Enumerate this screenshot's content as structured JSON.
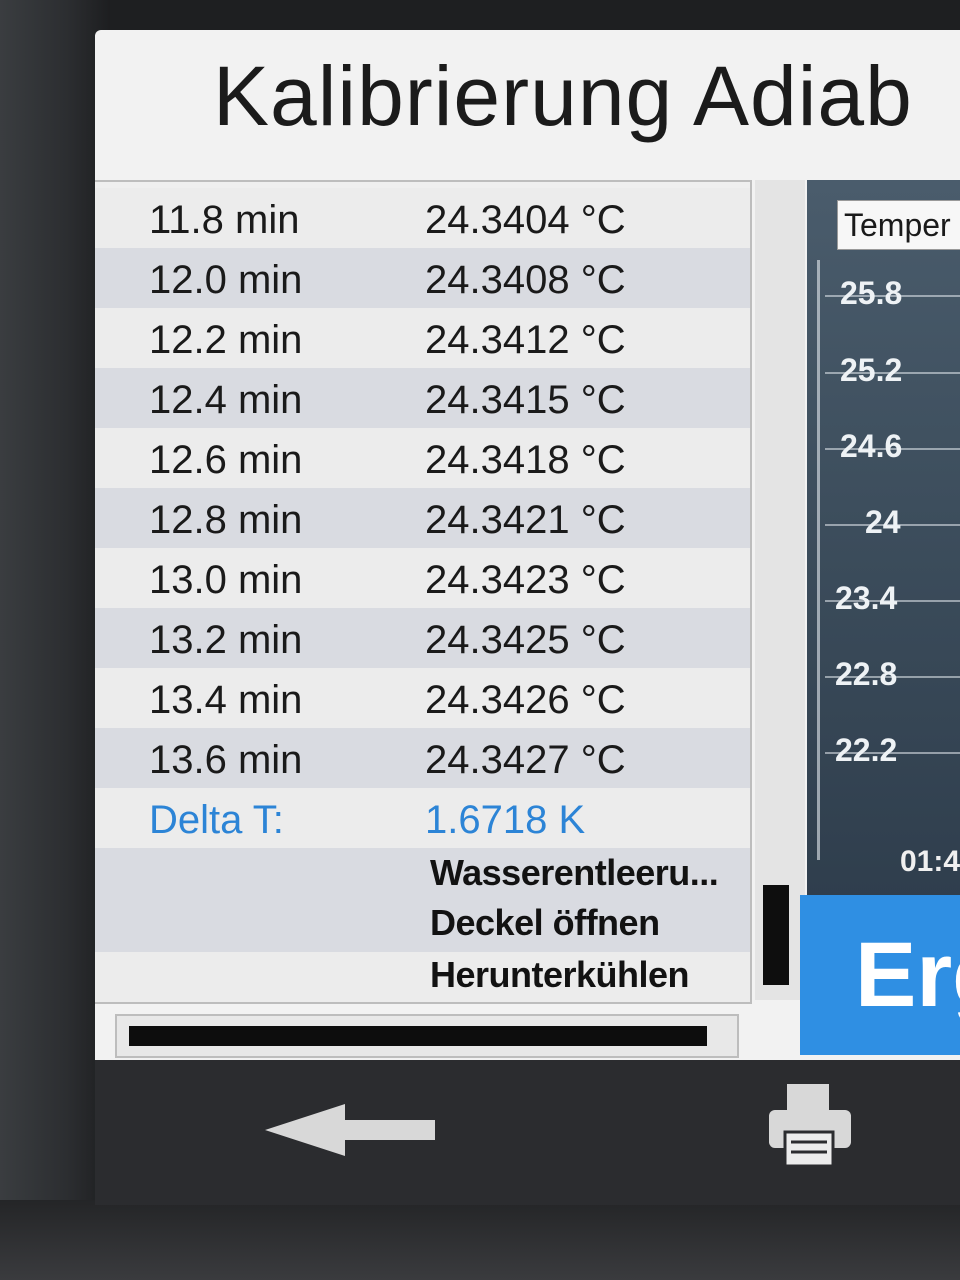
{
  "header": {
    "title": "Kalibrierung Adiab"
  },
  "rows": [
    {
      "time": "11.8 min",
      "temp": "24.3404 °C"
    },
    {
      "time": "12.0 min",
      "temp": "24.3408 °C"
    },
    {
      "time": "12.2 min",
      "temp": "24.3412 °C"
    },
    {
      "time": "12.4 min",
      "temp": "24.3415 °C"
    },
    {
      "time": "12.6 min",
      "temp": "24.3418 °C"
    },
    {
      "time": "12.8 min",
      "temp": "24.3421 °C"
    },
    {
      "time": "13.0 min",
      "temp": "24.3423 °C"
    },
    {
      "time": "13.2 min",
      "temp": "24.3425 °C"
    },
    {
      "time": "13.4 min",
      "temp": "24.3426 °C"
    },
    {
      "time": "13.6 min",
      "temp": "24.3427 °C"
    }
  ],
  "delta": {
    "label": "Delta T:",
    "value": "1.6718 K"
  },
  "actions": [
    "Wasserentleeru...",
    "Deckel öffnen",
    "Herunterkühlen"
  ],
  "progress": {
    "fraction": 0.97
  },
  "chart": {
    "legend": "Temper",
    "y_ticks": [
      "25.8",
      "25.2",
      "24.6",
      "24",
      "23.4",
      "22.8",
      "22.2"
    ],
    "x_label": "01:4"
  },
  "result_button": {
    "label": "Erg"
  },
  "toolbar": {
    "back_icon": "arrow-left-icon",
    "print_icon": "printer-icon"
  },
  "colors": {
    "accent": "#2f8fe3",
    "delta_text": "#2c84d6"
  }
}
